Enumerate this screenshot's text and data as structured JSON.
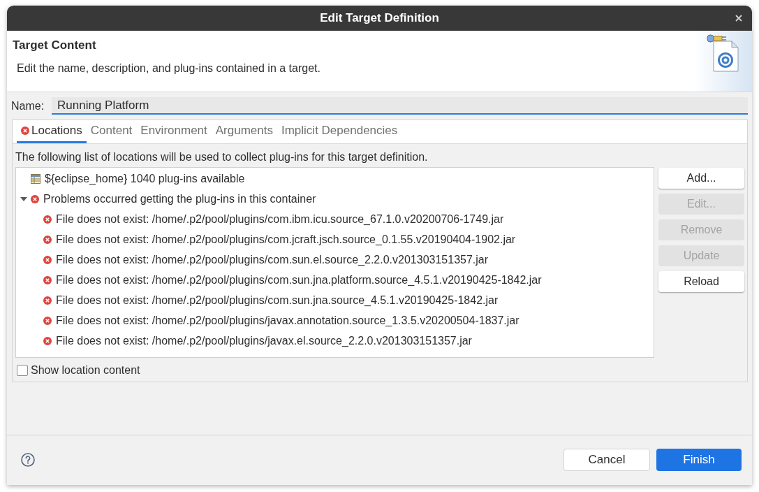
{
  "window": {
    "title": "Edit Target Definition"
  },
  "header": {
    "title": "Target Content",
    "description": "Edit the name, description, and plug-ins contained in a target."
  },
  "name_field": {
    "label": "Name:",
    "value": "Running Platform"
  },
  "tabs": [
    {
      "label": "Locations",
      "selected": true,
      "error": true
    },
    {
      "label": "Content",
      "selected": false,
      "error": false
    },
    {
      "label": "Environment",
      "selected": false,
      "error": false
    },
    {
      "label": "Arguments",
      "selected": false,
      "error": false
    },
    {
      "label": "Implicit Dependencies",
      "selected": false,
      "error": false
    }
  ],
  "locations": {
    "description": "The following list of locations will be used to collect plug-ins for this target definition.",
    "tree": [
      {
        "kind": "location",
        "label": "${eclipse_home} 1040 plug-ins available"
      },
      {
        "kind": "error",
        "label": "Problems occurred getting the plug-ins in this container",
        "expanded": true,
        "children": [
          {
            "kind": "error",
            "label": "File does not exist: /home/.p2/pool/plugins/com.ibm.icu.source_67.1.0.v20200706-1749.jar"
          },
          {
            "kind": "error",
            "label": "File does not exist: /home/.p2/pool/plugins/com.jcraft.jsch.source_0.1.55.v20190404-1902.jar"
          },
          {
            "kind": "error",
            "label": "File does not exist: /home/.p2/pool/plugins/com.sun.el.source_2.2.0.v201303151357.jar"
          },
          {
            "kind": "error",
            "label": "File does not exist: /home/.p2/pool/plugins/com.sun.jna.platform.source_4.5.1.v20190425-1842.jar"
          },
          {
            "kind": "error",
            "label": "File does not exist: /home/.p2/pool/plugins/com.sun.jna.source_4.5.1.v20190425-1842.jar"
          },
          {
            "kind": "error",
            "label": "File does not exist: /home/.p2/pool/plugins/javax.annotation.source_1.3.5.v20200504-1837.jar"
          },
          {
            "kind": "error",
            "label": "File does not exist: /home/.p2/pool/plugins/javax.el.source_2.2.0.v201303151357.jar"
          }
        ]
      }
    ]
  },
  "side_buttons": [
    {
      "label": "Add...",
      "disabled": false
    },
    {
      "label": "Edit...",
      "disabled": true
    },
    {
      "label": "Remove",
      "disabled": true
    },
    {
      "label": "Update",
      "disabled": true
    },
    {
      "label": "Reload",
      "disabled": false
    }
  ],
  "show_location_content": {
    "label": "Show location content",
    "checked": false
  },
  "footer_buttons": [
    {
      "label": "Cancel",
      "kind": "secondary"
    },
    {
      "label": "Finish",
      "kind": "primary"
    }
  ]
}
